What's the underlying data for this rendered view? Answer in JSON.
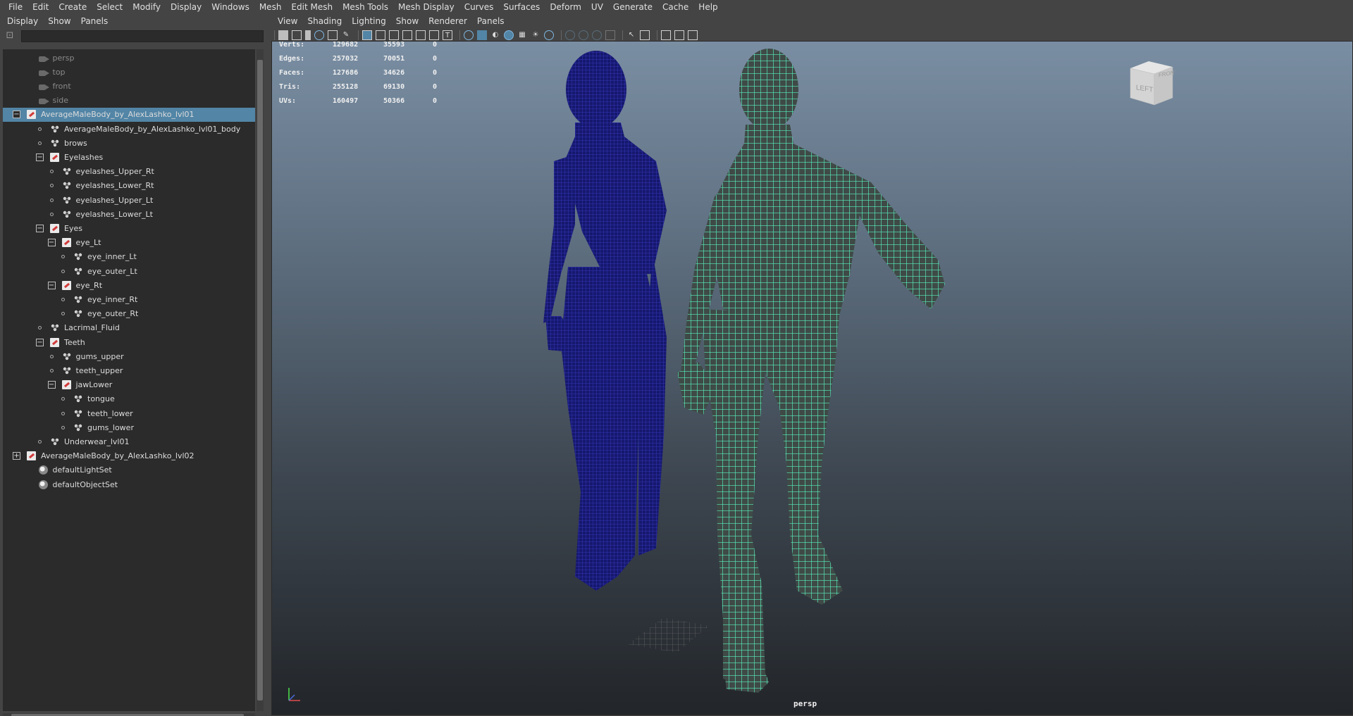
{
  "colors": {
    "selection": "#5285a6",
    "tree_bg": "#2b2b2b",
    "mesh_blue": "#1b1e8c",
    "mesh_green": "#4de3b0",
    "ui_bg": "#444444"
  },
  "main_menu": [
    "File",
    "Edit",
    "Create",
    "Select",
    "Modify",
    "Display",
    "Windows",
    "Mesh",
    "Edit Mesh",
    "Mesh Tools",
    "Mesh Display",
    "Curves",
    "Surfaces",
    "Deform",
    "UV",
    "Generate",
    "Cache",
    "Help"
  ],
  "outliner": {
    "menu": [
      "Display",
      "Show",
      "Panels"
    ],
    "search_icon": "filter-icon",
    "search_value": "",
    "items": [
      {
        "label": "persp",
        "icon": "camera-icon",
        "dim": true
      },
      {
        "label": "top",
        "icon": "camera-icon",
        "dim": true
      },
      {
        "label": "front",
        "icon": "camera-icon",
        "dim": true
      },
      {
        "label": "side",
        "icon": "camera-icon",
        "dim": true
      },
      {
        "label": "AverageMaleBody_by_AlexLashko_lvl01",
        "icon": "group-icon",
        "expander": "−",
        "selected": true
      },
      {
        "label": "AverageMaleBody_by_AlexLashko_lvl01_body",
        "icon": "mesh-icon"
      },
      {
        "label": "brows",
        "icon": "mesh-icon"
      },
      {
        "label": "Eyelashes",
        "icon": "group-icon",
        "expander": "−"
      },
      {
        "label": "eyelashes_Upper_Rt",
        "icon": "mesh-icon"
      },
      {
        "label": "eyelashes_Lower_Rt",
        "icon": "mesh-icon"
      },
      {
        "label": "eyelashes_Upper_Lt",
        "icon": "mesh-icon"
      },
      {
        "label": "eyelashes_Lower_Lt",
        "icon": "mesh-icon"
      },
      {
        "label": "Eyes",
        "icon": "group-icon",
        "expander": "−"
      },
      {
        "label": "eye_Lt",
        "icon": "group-icon",
        "expander": "−"
      },
      {
        "label": "eye_inner_Lt",
        "icon": "mesh-icon"
      },
      {
        "label": "eye_outer_Lt",
        "icon": "mesh-icon"
      },
      {
        "label": "eye_Rt",
        "icon": "group-icon",
        "expander": "−"
      },
      {
        "label": "eye_inner_Rt",
        "icon": "mesh-icon"
      },
      {
        "label": "eye_outer_Rt",
        "icon": "mesh-icon"
      },
      {
        "label": "Lacrimal_Fluid",
        "icon": "mesh-icon"
      },
      {
        "label": "Teeth",
        "icon": "group-icon",
        "expander": "−"
      },
      {
        "label": "gums_upper",
        "icon": "mesh-icon"
      },
      {
        "label": "teeth_upper",
        "icon": "mesh-icon"
      },
      {
        "label": "jawLower",
        "icon": "group-icon",
        "expander": "−"
      },
      {
        "label": "tongue",
        "icon": "mesh-icon"
      },
      {
        "label": "teeth_lower",
        "icon": "mesh-icon"
      },
      {
        "label": "gums_lower",
        "icon": "mesh-icon"
      },
      {
        "label": "Underwear_lvl01",
        "icon": "mesh-icon"
      },
      {
        "label": "AverageMaleBody_by_AlexLashko_lvl02",
        "icon": "group-icon",
        "expander": "+"
      },
      {
        "label": "defaultLightSet",
        "icon": "set-icon"
      },
      {
        "label": "defaultObjectSet",
        "icon": "set-icon"
      }
    ]
  },
  "viewport": {
    "menu": [
      "View",
      "Shading",
      "Lighting",
      "Show",
      "Renderer",
      "Panels"
    ],
    "camera": "persp",
    "viewcube_faces": [
      "LEFT",
      "FRONT"
    ],
    "hud": [
      {
        "label": "Verts:",
        "v1": "129682",
        "v2": "35593",
        "v3": "0"
      },
      {
        "label": "Edges:",
        "v1": "257032",
        "v2": "70051",
        "v3": "0"
      },
      {
        "label": "Faces:",
        "v1": "127686",
        "v2": "34626",
        "v3": "0"
      },
      {
        "label": "Tris:",
        "v1": "255128",
        "v2": "69130",
        "v3": "0"
      },
      {
        "label": "UVs:",
        "v1": "160497",
        "v2": "50366",
        "v3": "0"
      }
    ]
  }
}
